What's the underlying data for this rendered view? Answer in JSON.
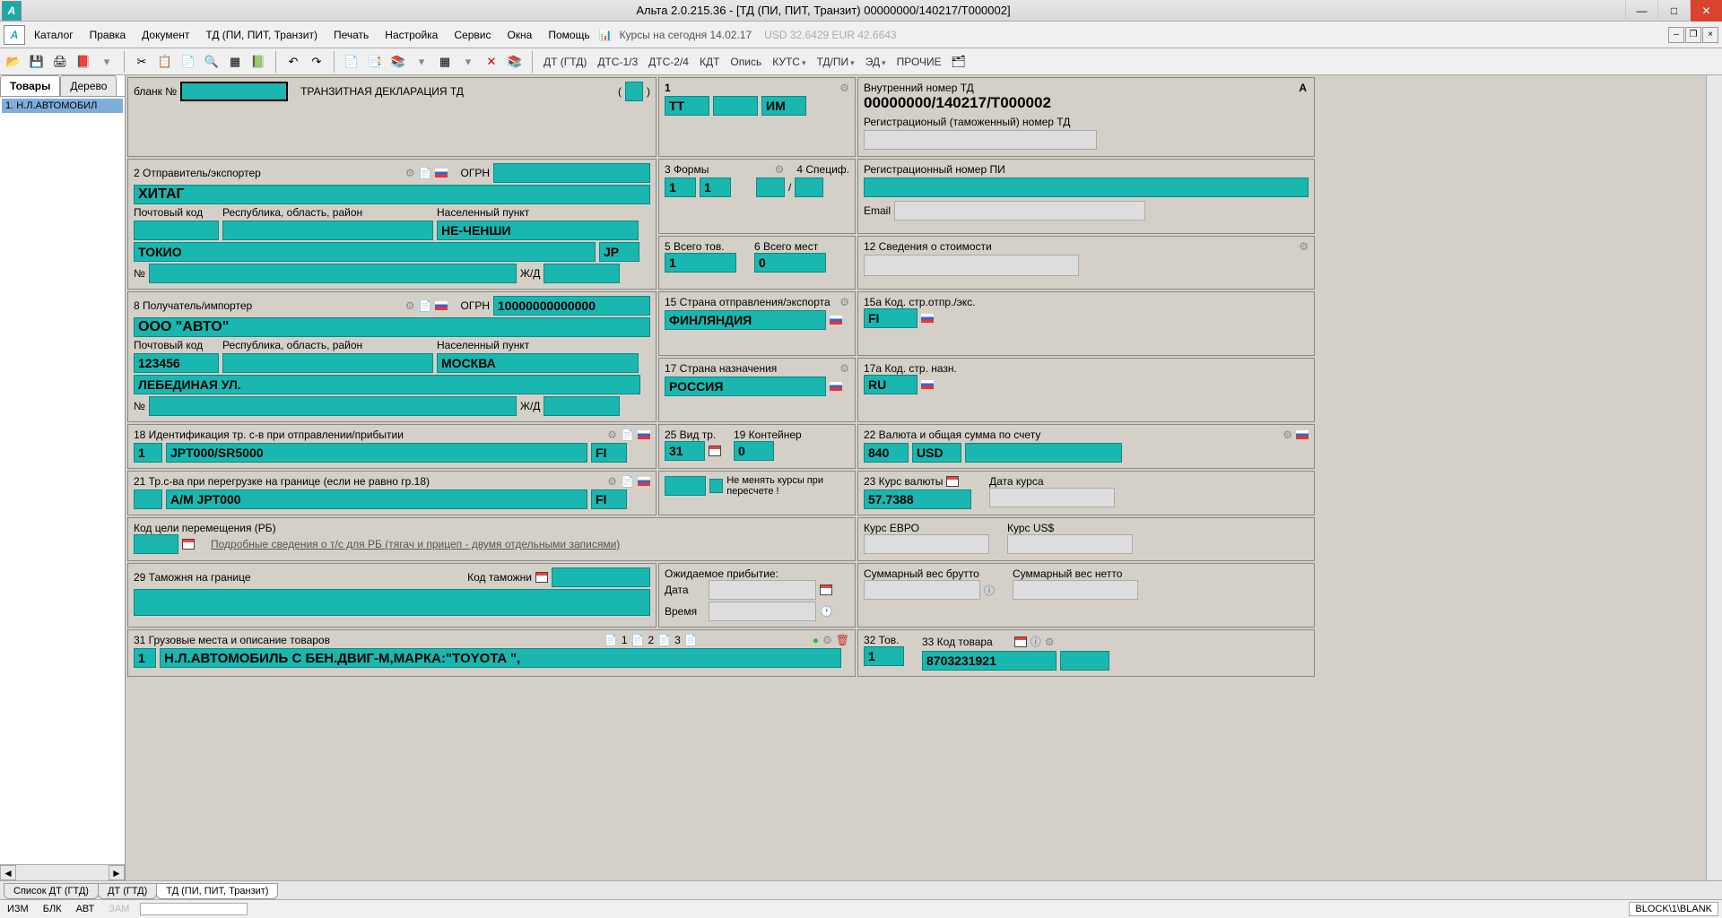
{
  "window": {
    "title": "Альта 2.0.215.36 - [ТД (ПИ, ПИТ, Транзит) 00000000/140217/T000002]"
  },
  "menu": {
    "items": [
      "Каталог",
      "Правка",
      "Документ",
      "ТД (ПИ, ПИТ, Транзит)",
      "Печать",
      "Настройка",
      "Сервис",
      "Окна",
      "Помощь"
    ],
    "rates_label": "Курсы на сегодня 14.02.17",
    "rates_values": "USD 32.6429   EUR 42.6643"
  },
  "toolbar": {
    "links": [
      "ДТ (ГТД)",
      "ДТС-1/3",
      "ДТС-2/4",
      "КДТ",
      "Опись",
      "КУТС",
      "ТД/ПИ",
      "ЭД",
      "ПРОЧИЕ"
    ]
  },
  "leftpanel": {
    "tabs": [
      "Товары",
      "Дерево"
    ],
    "items": [
      "1. Н.Л.АВТОМОБИЛ"
    ]
  },
  "form": {
    "blank_label": "бланк №",
    "doc_title": "ТРАНЗИТНАЯ ДЕКЛАРАЦИЯ   ТД",
    "f1": "1",
    "tt": "ТТ",
    "im": "ИМ",
    "internal_label": "Внутренний номер ТД",
    "internal_num": "00000000/140217/T000002",
    "marker": "A",
    "f2_label": "2 Отправитель/экспортер",
    "ogrn_label": "ОГРН",
    "f2_name": "ХИТАГ",
    "post_label": "Почтовый код",
    "region_label": "Республика, область, район",
    "city_label": "Населенный пункт",
    "f2_city": "НЕ-ЧЕНШИ",
    "f2_region": "ТОКИО",
    "f2_country": "JP",
    "num_label": "№",
    "rail_label": "Ж/Д",
    "reg_td_label": "Регистрационый (таможенный) номер ТД",
    "reg_pi_label": "Регистрационный номер ПИ",
    "email_label": "Email",
    "f3_label": "3 Формы",
    "f3_v1": "1",
    "f3_v2": "1",
    "f4_label": "4 Специф.",
    "f4_sep": "/",
    "f5_label": "5 Всего тов.",
    "f5_val": "1",
    "f6_label": "6 Всего мест",
    "f6_val": "0",
    "f12_label": "12 Сведения о стоимости",
    "f8_label": "8 Получатель/импортер",
    "f8_ogrn": "10000000000000",
    "f8_name": "ООО \"АВТО\"",
    "f8_post": "123456",
    "f8_city": "МОСКВА",
    "f8_street": "ЛЕБЕДИНАЯ УЛ.",
    "f15_label": "15 Страна отправления/экспорта",
    "f15_val": "ФИНЛЯНДИЯ",
    "f15a_label": "15а Код. стр.отпр./экс.",
    "f15a_val": "FI",
    "f17_label": "17 Страна назначения",
    "f17_val": "РОССИЯ",
    "f17a_label": "17а Код. стр. назн.",
    "f17a_val": "RU",
    "f18_label": "18 Идентификация тр. с-в при отправлении/прибытии",
    "f18_count": "1",
    "f18_val": "JPT000/SR5000",
    "f18_code": "FI",
    "f25_label": "25 Вид тр.",
    "f25_val": "31",
    "f19_label": "19 Контейнер",
    "f19_val": "0",
    "f22_label": "22 Валюта и общая сумма по счету",
    "f22_code": "840",
    "f22_cur": "USD",
    "f21_label": "21 Тр.с-ва при перегрузке на границе (если не равно гр.18)",
    "f21_val": "А/М JPT000",
    "f21_code": "FI",
    "keep_rates": "Не менять курсы при пересчете !",
    "f23_label": "23 Курс валюты",
    "f23_val": "57.7388",
    "rate_date_label": "Дата курса",
    "rb_label": "Код цели перемещения (РБ)",
    "rb_link": "Подробные сведения о т/с для РБ (тягач и прицеп - двумя отдельными записями)",
    "euro_label": "Курс ЕВРО",
    "usd_label": "Курс US$",
    "f29_label": "29 Таможня на границе",
    "f29_code_label": "Код таможни",
    "expected_label": "Ожидаемое прибытие:",
    "date_label": "Дата",
    "time_label": "Время",
    "gross_label": "Суммарный вес брутто",
    "net_label": "Суммарный вес нетто",
    "f31_label": "31 Грузовые места и описание товаров",
    "f31_n": "1",
    "f31_val": "Н.Л.АВТОМОБИЛЬ С БЕН.ДВИГ-М,МАРКА:\"TOYOTA \",",
    "f32_label": "32 Тов.",
    "f32_val": "1",
    "f33_label": "33 Код товара",
    "f33_val": "8703231921",
    "page_indicators": [
      "1",
      "2",
      "3"
    ]
  },
  "bottomtabs": [
    "Список ДТ (ГТД)",
    "ДТ (ГТД)",
    "ТД (ПИ, ПИТ, Транзит)"
  ],
  "status": {
    "izm": "ИЗМ",
    "blk": "БЛК",
    "avt": "АВТ",
    "zam": "ЗАМ",
    "path": "BLOCK\\1\\BLANK"
  }
}
